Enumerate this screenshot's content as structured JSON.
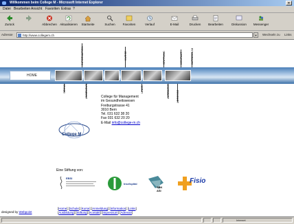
{
  "window": {
    "title": "Willkommen beim College M - Microsoft Internet Explorer"
  },
  "menu": [
    "Datei",
    "Bearbeiten",
    "Ansicht",
    "Favoriten",
    "Extras",
    "?"
  ],
  "toolbar": [
    {
      "label": "Zurück",
      "icon": "back-arrow-icon"
    },
    {
      "label": "",
      "icon": "forward-arrow-icon"
    },
    {
      "label": "Abbrechen",
      "icon": "stop-icon"
    },
    {
      "label": "Aktualisieren",
      "icon": "refresh-icon"
    },
    {
      "label": "Startseite",
      "icon": "home-icon"
    },
    {
      "label": "Suchen",
      "icon": "search-icon"
    },
    {
      "label": "Favoriten",
      "icon": "favorites-icon"
    },
    {
      "label": "Verlauf",
      "icon": "history-icon"
    },
    {
      "label": "E-Mail",
      "icon": "mail-icon"
    },
    {
      "label": "Drucken",
      "icon": "print-icon"
    },
    {
      "label": "Bearbeiten",
      "icon": "edit-icon"
    },
    {
      "label": "Diskussion",
      "icon": "discuss-icon"
    },
    {
      "label": "Messenger",
      "icon": "messenger-icon"
    }
  ],
  "address": {
    "label": "Adresse",
    "url": "http://www.collegem.ch",
    "go_label": "Wechseln zu",
    "links_label": "Links"
  },
  "nav": {
    "home": "HOME",
    "vertical_labels": [
      "SCHULE",
      "KURSE",
      "INFORMATION",
      "ANMELDUNG",
      "AUSBILDUNG",
      "STIFTUNG",
      "LINKS",
      "KONTAKT",
      "IMPRESSUM",
      "ADRESSE"
    ]
  },
  "contact": {
    "lines": [
      "College für Management",
      "im Gesundheitswesen",
      "Freiburgstrasse 41",
      "3010 Bern",
      "Tel. 031 632 38 20",
      "Fax 031 632 20 20"
    ],
    "email_label": "E-Mail",
    "email": "info@college-m.ch"
  },
  "logo_text": "College M",
  "stiftung": {
    "heading": "Eine Stiftung von:",
    "sponsors": [
      "EBSI",
      "Inselspital",
      "SBK ASI",
      "Fisio"
    ]
  },
  "footer": {
    "credit_prefix": "designed by",
    "credit_link": "Webpoint",
    "links_row1": [
      "Home",
      "Schule",
      "Kurse",
      "Anmeldung",
      "Information",
      "Links"
    ],
    "links_row2": [
      "Ausbildung",
      "Stiftung",
      "Kontakt",
      "Impressum",
      "Adresse"
    ]
  },
  "status": {
    "zone": "Internet"
  },
  "colors": {
    "titlebar": "#0a246a",
    "chrome": "#d4d0c8",
    "navbar": "#4a7fb8",
    "link": "#0000cc"
  }
}
